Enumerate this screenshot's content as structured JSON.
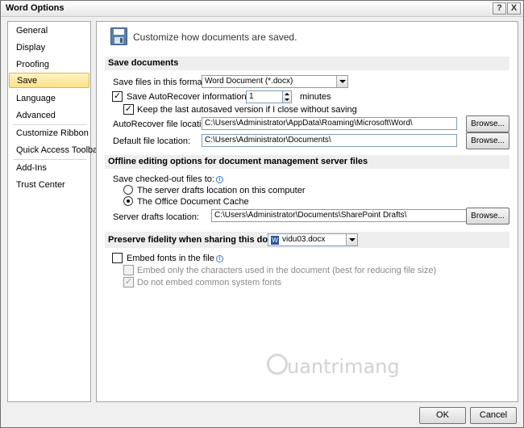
{
  "window": {
    "title": "Word Options",
    "help_glyph": "?",
    "close_glyph": "X"
  },
  "sidebar": {
    "items": [
      {
        "label": "General"
      },
      {
        "label": "Display"
      },
      {
        "label": "Proofing"
      },
      {
        "label": "Save"
      },
      {
        "label": "Language"
      },
      {
        "label": "Advanced"
      },
      {
        "label": "Customize Ribbon"
      },
      {
        "label": "Quick Access Toolbar"
      },
      {
        "label": "Add-Ins"
      },
      {
        "label": "Trust Center"
      }
    ],
    "selected": "Save"
  },
  "header": {
    "text": "Customize how documents are saved."
  },
  "save_documents": {
    "section_title": "Save documents",
    "format_label": "Save files in this format:",
    "format_value": "Word Document (*.docx)",
    "autorecover_label": "Save AutoRecover information every",
    "autorecover_checked": true,
    "autorecover_minutes": "1",
    "minutes_label": "minutes",
    "keep_last_label": "Keep the last autosaved version if I close without saving",
    "keep_last_checked": true,
    "autorecover_location_label": "AutoRecover file location:",
    "autorecover_location_value": "C:\\Users\\Administrator\\AppData\\Roaming\\Microsoft\\Word\\",
    "default_location_label": "Default file location:",
    "default_location_value": "C:\\Users\\Administrator\\Documents\\",
    "browse_label": "Browse..."
  },
  "offline": {
    "section_title": "Offline editing options for document management server files",
    "save_checked_out_label": "Save checked-out files to:",
    "option_server": "The server drafts location on this computer",
    "option_cache": "The Office Document Cache",
    "selected_option": "The Office Document Cache",
    "server_drafts_label": "Server drafts location:",
    "server_drafts_value": "C:\\Users\\Administrator\\Documents\\SharePoint Drafts\\",
    "browse_label": "Browse..."
  },
  "fidelity": {
    "section_label": "Preserve fidelity when sharing this document:",
    "document_value": "vidu03.docx",
    "embed_fonts_label": "Embed fonts in the file",
    "embed_fonts_checked": false,
    "embed_only_label": "Embed only the characters used in the document (best for reducing file size)",
    "embed_only_checked": false,
    "no_common_label": "Do not embed common system fonts",
    "no_common_checked": true
  },
  "footer": {
    "ok_label": "OK",
    "cancel_label": "Cancel"
  },
  "watermark": {
    "text": "uantrimang"
  },
  "colors": {
    "selection_bg": "#fde08a",
    "section_bg": "#eeeeee",
    "info_icon": "#3a78c9"
  }
}
